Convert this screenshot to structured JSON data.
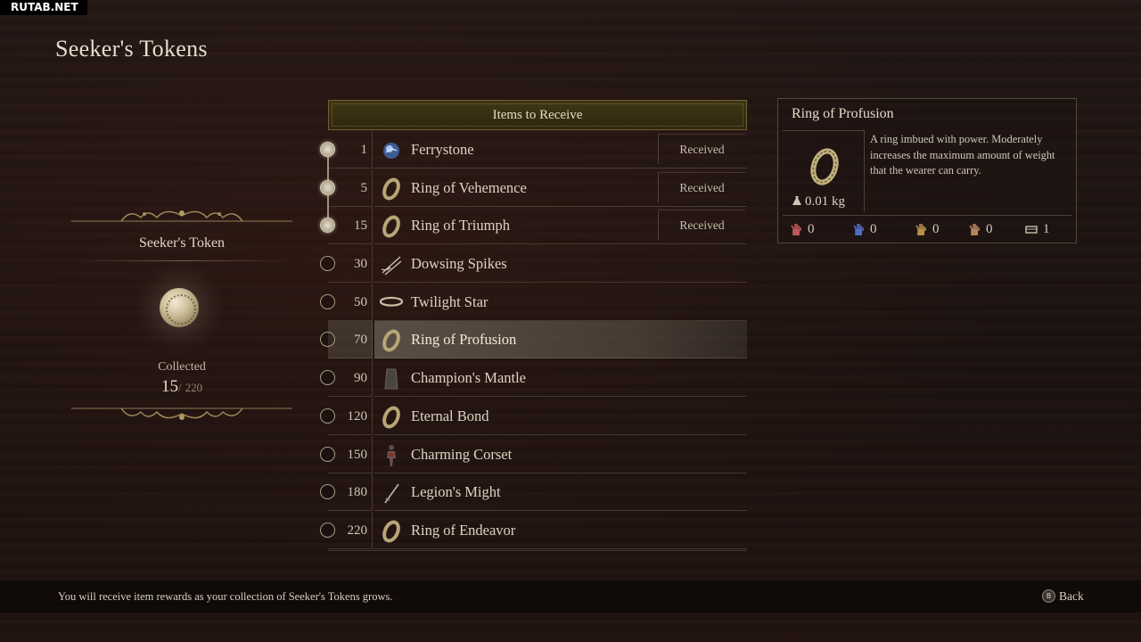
{
  "watermark": "RUTAB.NET",
  "page_title": "Seeker's Tokens",
  "token_panel": {
    "name": "Seeker's Token",
    "collected_label": "Collected",
    "collected": "15",
    "separator": "/",
    "total": "220"
  },
  "list": {
    "header": "Items to Receive",
    "received_label": "Received",
    "rows": [
      {
        "req": "1",
        "name": "Ferrystone",
        "icon": "ferrystone-icon",
        "received": true
      },
      {
        "req": "5",
        "name": "Ring of Vehemence",
        "icon": "ring-icon",
        "received": true
      },
      {
        "req": "15",
        "name": "Ring of Triumph",
        "icon": "ring-icon",
        "received": true
      },
      {
        "req": "30",
        "name": "Dowsing Spikes",
        "icon": "spikes-icon",
        "received": false
      },
      {
        "req": "50",
        "name": "Twilight Star",
        "icon": "circlet-icon",
        "received": false
      },
      {
        "req": "70",
        "name": "Ring of Profusion",
        "icon": "ring-icon",
        "received": false,
        "selected": true
      },
      {
        "req": "90",
        "name": "Champion's Mantle",
        "icon": "mantle-icon",
        "received": false
      },
      {
        "req": "120",
        "name": "Eternal Bond",
        "icon": "ring-icon",
        "received": false
      },
      {
        "req": "150",
        "name": "Charming Corset",
        "icon": "armor-icon",
        "received": false
      },
      {
        "req": "180",
        "name": "Legion's Might",
        "icon": "sword-icon",
        "received": false
      },
      {
        "req": "220",
        "name": "Ring of Endeavor",
        "icon": "ring-icon",
        "received": false
      }
    ]
  },
  "detail": {
    "title": "Ring of Profusion",
    "description": "A ring imbued with power. Moderately increases the maximum amount of weight that the wearer can carry.",
    "weight": "0.01 kg",
    "stats": [
      {
        "icon": "red-hand-icon",
        "value": "0"
      },
      {
        "icon": "blue-hand-icon",
        "value": "0"
      },
      {
        "icon": "gold-hand-icon",
        "value": "0"
      },
      {
        "icon": "tan-hand-icon",
        "value": "0"
      },
      {
        "icon": "chest-icon",
        "value": "1"
      }
    ]
  },
  "footer": {
    "hint": "You will receive item rewards as your collection of Seeker's Tokens grows.",
    "back_button_glyph": "B",
    "back_label": "Back"
  },
  "colors": {
    "header_gold": "#3f3614",
    "text": "#d8d0bf",
    "selected_row": "#827d6e"
  }
}
